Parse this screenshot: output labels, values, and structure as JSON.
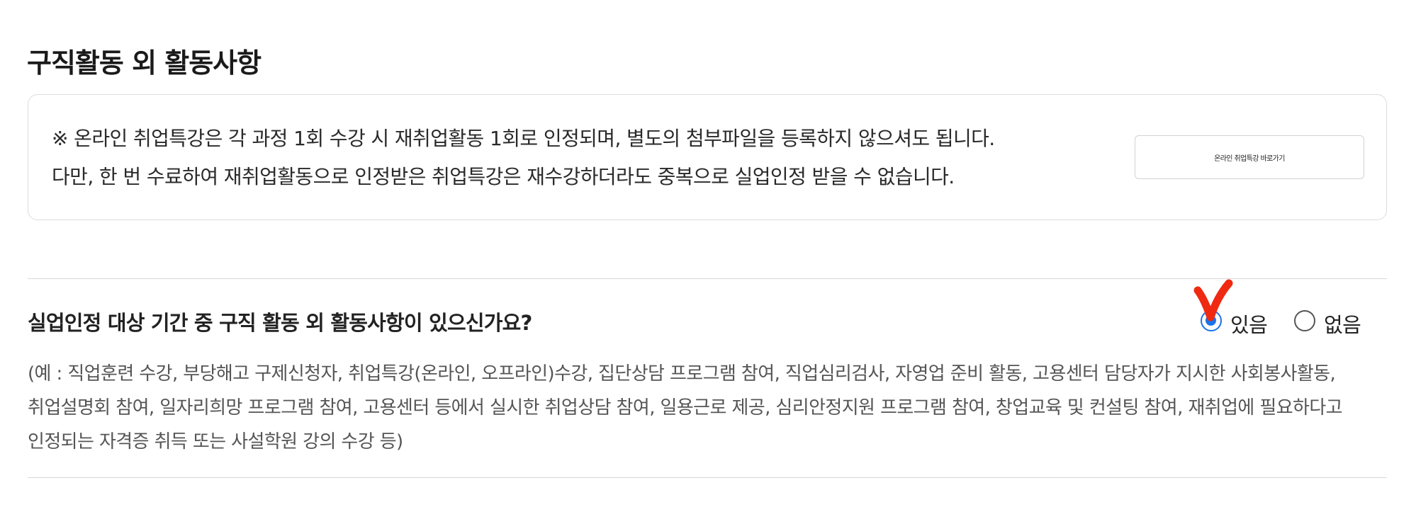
{
  "section": {
    "title": "구직활동 외 활동사항"
  },
  "notice": {
    "line1": "※ 온라인 취업특강은 각 과정 1회 수강 시 재취업활동 1회로 인정되며, 별도의 첨부파일을 등록하지 않으셔도 됩니다.",
    "line2": "다만, 한 번 수료하여 재취업활동으로 인정받은 취업특강은 재수강하더라도 중복으로 실업인정 받을 수 없습니다.",
    "button_label": "온라인 취업특강 바로가기"
  },
  "question": {
    "label": "실업인정 대상 기간 중 구직 활동 외 활동사항이 있으신가요?",
    "options": [
      {
        "label": "있음",
        "checked": true
      },
      {
        "label": "없음",
        "checked": false
      }
    ],
    "accent_color": "#1a73e8",
    "annotation_color": "#f02a12",
    "examples": [
      "(예 : 직업훈련 수강, 부당해고 구제신청자, 취업특강(온라인, 오프라인)수강, 집단상담 프로그램 참여, 직업심리검사, 자영업 준비 활동, 고용센터 담당자가 지시한 사회봉사활동,",
      "취업설명회 참여, 일자리희망 프로그램 참여, 고용센터 등에서 실시한 취업상담 참여, 일용근로 제공, 심리안정지원 프로그램 참여, 창업교육 및 컨설팅 참여, 재취업에 필요하다고",
      "인정되는 자격증 취득 또는 사설학원 강의 수강 등)"
    ]
  }
}
